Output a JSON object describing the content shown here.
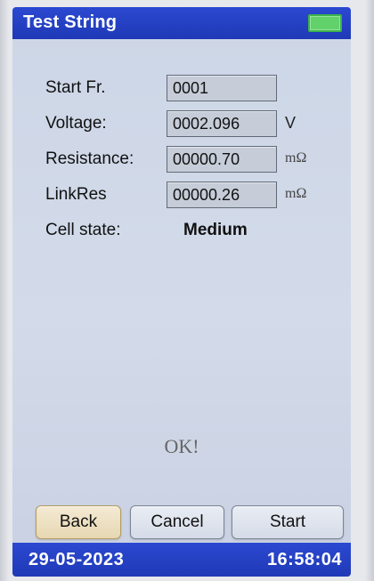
{
  "header": {
    "title": "Test String",
    "battery_icon": "battery-icon",
    "battery_color": "#61d16a"
  },
  "form": {
    "start_fr": {
      "label": "Start Fr.",
      "value": "0001"
    },
    "voltage": {
      "label": "Voltage:",
      "value": "0002.096",
      "unit": "V"
    },
    "resistance": {
      "label": "Resistance:",
      "value": "00000.70",
      "unit": "mΩ"
    },
    "linkres": {
      "label": "LinkRes",
      "value": "00000.26",
      "unit": "mΩ"
    },
    "cell_state": {
      "label": "Cell state:",
      "value": "Medium"
    }
  },
  "status": {
    "message": "OK!"
  },
  "buttons": {
    "back": "Back",
    "cancel": "Cancel",
    "start": "Start"
  },
  "footer": {
    "date": "29-05-2023",
    "time": "16:58:04"
  },
  "colors": {
    "bar_blue": "#1f39b6"
  }
}
